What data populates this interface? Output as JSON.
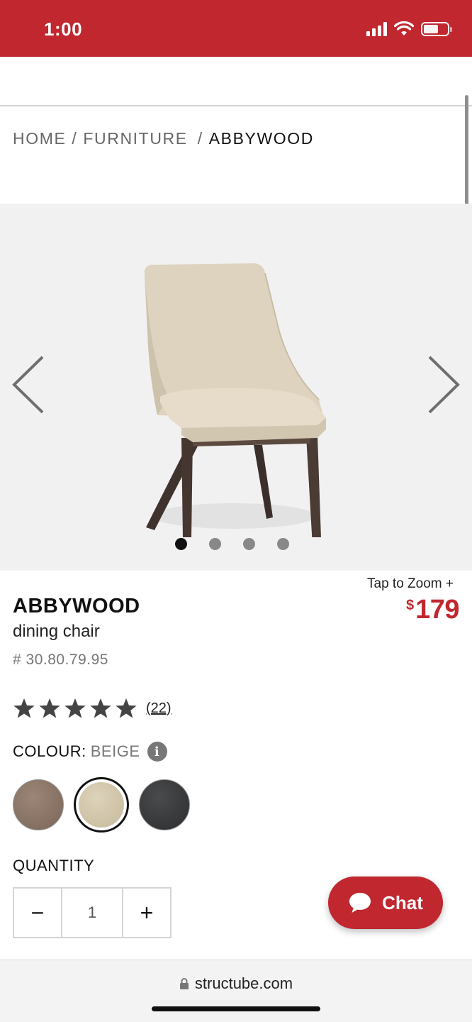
{
  "status_bar": {
    "time": "1:00"
  },
  "breadcrumb": {
    "home": "HOME",
    "sep1": "/",
    "furniture": "FURNITURE",
    "sep2": "/",
    "current": "ABBYWOOD"
  },
  "gallery": {
    "slide_count": 4,
    "active_slide": 1
  },
  "product": {
    "tap_to_zoom": "Tap to Zoom +",
    "name": "ABBYWOOD",
    "type": "dining chair",
    "sku": "# 30.80.79.95",
    "price_currency": "$",
    "price_amount": "179",
    "rating_stars": 5,
    "rating_count": "(22)",
    "colour_label": "COLOUR:",
    "colour_value": "BEIGE",
    "colour_info": "i",
    "swatches": [
      {
        "name": "brown",
        "color": "#8a7466"
      },
      {
        "name": "beige",
        "color": "#d3c7ad",
        "selected": true
      },
      {
        "name": "charcoal",
        "color": "#3a3b3d"
      }
    ],
    "quantity_label": "QUANTITY",
    "quantity_minus": "−",
    "quantity_value": "1",
    "quantity_plus": "+"
  },
  "chat": {
    "label": "Chat"
  },
  "browser": {
    "url": "structube.com"
  },
  "colors": {
    "brand_red": "#c0272f"
  }
}
